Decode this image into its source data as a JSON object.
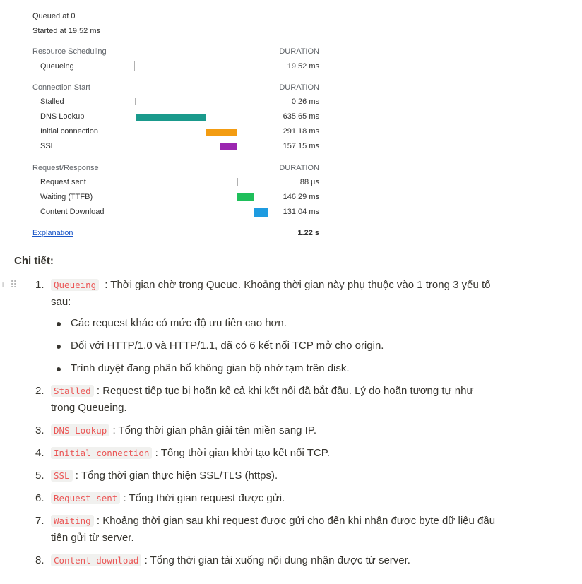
{
  "timing": {
    "queued_at": "Queued at 0",
    "started_at": "Started at 19.52 ms",
    "duration_label": "DURATION",
    "sections": [
      {
        "title": "Resource Scheduling",
        "rows": [
          {
            "label": "Queueing",
            "duration": "19.52 ms",
            "color": "#b0b0b0"
          }
        ]
      },
      {
        "title": "Connection Start",
        "rows": [
          {
            "label": "Stalled",
            "duration": "0.26 ms",
            "color": "#b0b0b0"
          },
          {
            "label": "DNS Lookup",
            "duration": "635.65 ms",
            "color": "#1a9a8c"
          },
          {
            "label": "Initial connection",
            "duration": "291.18 ms",
            "color": "#f39c12"
          },
          {
            "label": "SSL",
            "duration": "157.15 ms",
            "color": "#9b27b0"
          }
        ]
      },
      {
        "title": "Request/Response",
        "rows": [
          {
            "label": "Request sent",
            "duration": "88 µs",
            "color": "#b0b0b0"
          },
          {
            "label": "Waiting (TTFB)",
            "duration": "146.29 ms",
            "color": "#1fbf5b"
          },
          {
            "label": "Content Download",
            "duration": "131.04 ms",
            "color": "#1e9be0"
          }
        ]
      }
    ],
    "explanation_link": "Explanation",
    "total": "1.22 s"
  },
  "notes": {
    "heading": "Chi tiết:",
    "drag_handle": "+ ⠿",
    "items": [
      {
        "num": "1.",
        "code": "Queueing",
        "line1": ": Thời gian chờ trong Queue. Khoảng thời gian này phụ thuộc vào 1 trong 3 yếu tố",
        "line2": "sau:"
      },
      {
        "num": "2.",
        "code": "Stalled",
        "line1": ": Request tiếp tục bị hoãn kể cả khi kết nối đã bắt đầu. Lý do hoãn tương tự như",
        "line2": "trong Queueing."
      },
      {
        "num": "3.",
        "code": "DNS Lookup",
        "line1": ": Tổng thời gian phân giải tên miền sang IP.",
        "line2": ""
      },
      {
        "num": "4.",
        "code": "Initial connection",
        "line1": ": Tổng thời gian khởi tạo kết nối TCP.",
        "line2": ""
      },
      {
        "num": "5.",
        "code": "SSL",
        "line1": ": Tổng thời gian thực hiện SSL/TLS (https).",
        "line2": ""
      },
      {
        "num": "6.",
        "code": "Request sent",
        "line1": ": Tổng thời gian request được gửi.",
        "line2": ""
      },
      {
        "num": "7.",
        "code": "Waiting",
        "line1": ": Khoảng thời gian sau khi request được gửi cho đến khi nhận được byte dữ liệu đầu",
        "line2": "tiên gửi từ server."
      },
      {
        "num": "8.",
        "code": "Content download",
        "line1": ": Tổng thời gian tải xuống nội dung nhận được từ server.",
        "line2": ""
      }
    ],
    "bullets": [
      "Các request khác có mức độ ưu tiên cao hơn.",
      "Đối với HTTP/1.0 và HTTP/1.1, đã có 6 kết nối TCP mở cho origin.",
      "Trình duyệt đang phân bổ không gian bộ nhớ tạm trên disk."
    ]
  }
}
